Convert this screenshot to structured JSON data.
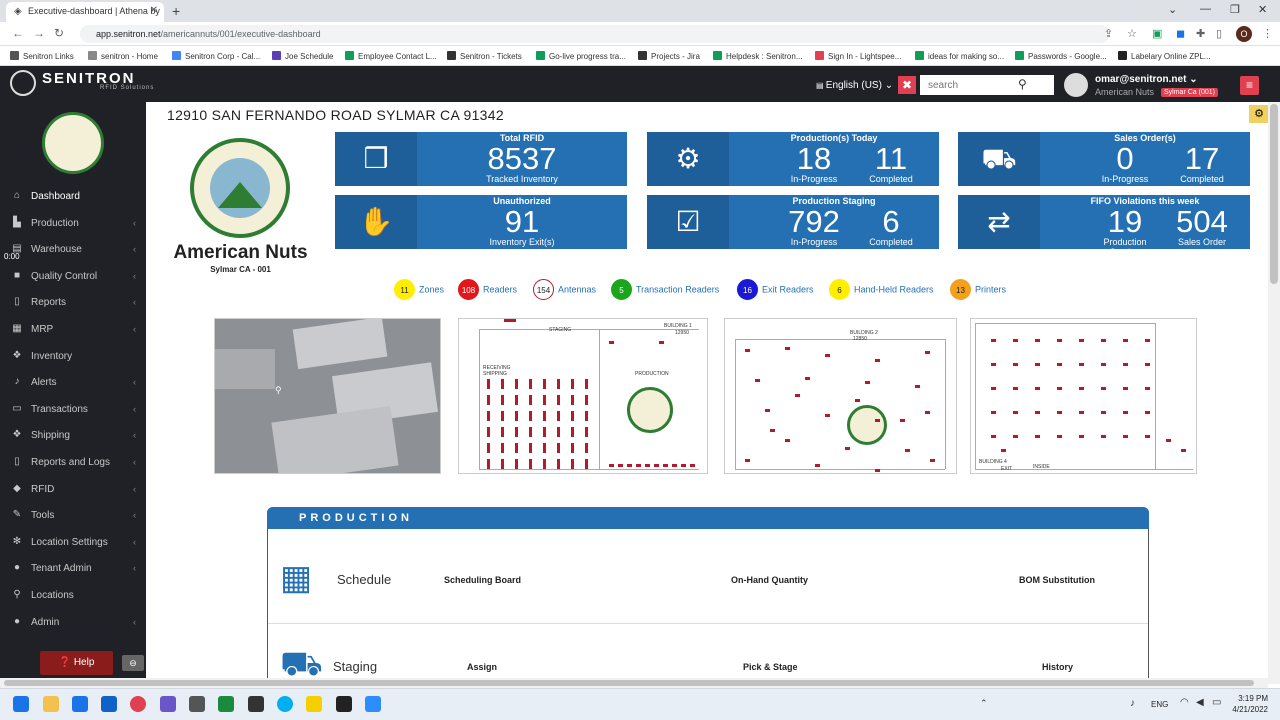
{
  "browser": {
    "tab_title": "Executive-dashboard | Athena by",
    "url_host": "app.senitron.net",
    "url_path": "/americannuts/001/executive-dashboard",
    "profile_initial": "O",
    "bookmarks": [
      {
        "label": "Senitron Links",
        "color": "#555555"
      },
      {
        "label": "senitron - Home",
        "color": "#888888"
      },
      {
        "label": "Senitron Corp - Cal...",
        "color": "#4285f4"
      },
      {
        "label": "Joe Schedule",
        "color": "#5c3fb5"
      },
      {
        "label": "Employee Contact L...",
        "color": "#0f9d58"
      },
      {
        "label": "Senitron - Tickets",
        "color": "#333333"
      },
      {
        "label": "Go-live progress tra...",
        "color": "#0f9d58"
      },
      {
        "label": "Projects - Jira",
        "color": "#333333"
      },
      {
        "label": "Helpdesk : Senitron...",
        "color": "#0f9d58"
      },
      {
        "label": "Sign In - Lightspee...",
        "color": "#e04050"
      },
      {
        "label": "ideas for making so...",
        "color": "#0f9d58"
      },
      {
        "label": "Passwords - Google...",
        "color": "#0f9d58"
      },
      {
        "label": "Labelary Online ZPL...",
        "color": "#222222"
      }
    ]
  },
  "header": {
    "brand": "SENITRON",
    "brand_sub": "RFID Solutions",
    "language": "English (US)",
    "search_placeholder": "search",
    "user_email": "omar@senitron.net",
    "tenant": "American Nuts",
    "location_badge": "Sylmar Ca (001)"
  },
  "sidebar": {
    "timer": "0:00",
    "items": [
      {
        "label": "Dashboard",
        "icon": "home-icon",
        "glyph": "⌂",
        "chevron": false,
        "active": true
      },
      {
        "label": "Production",
        "icon": "factory-icon",
        "glyph": "▙",
        "chevron": true
      },
      {
        "label": "Warehouse",
        "icon": "warehouse-icon",
        "glyph": "▤",
        "chevron": true
      },
      {
        "label": "Quality Control",
        "icon": "quality-icon",
        "glyph": "■",
        "chevron": true
      },
      {
        "label": "Reports",
        "icon": "file-icon",
        "glyph": "▯",
        "chevron": true
      },
      {
        "label": "MRP",
        "icon": "mrp-icon",
        "glyph": "▦",
        "chevron": true
      },
      {
        "label": "Inventory",
        "icon": "cubes-icon",
        "glyph": "❖",
        "chevron": false
      },
      {
        "label": "Alerts",
        "icon": "bell-icon",
        "glyph": "♪",
        "chevron": true
      },
      {
        "label": "Transactions",
        "icon": "transactions-icon",
        "glyph": "▭",
        "chevron": true
      },
      {
        "label": "Shipping",
        "icon": "shipping-icon",
        "glyph": "❖",
        "chevron": true
      },
      {
        "label": "Reports and Logs",
        "icon": "document-icon",
        "glyph": "▯",
        "chevron": true
      },
      {
        "label": "RFID",
        "icon": "tag-icon",
        "glyph": "◆",
        "chevron": true
      },
      {
        "label": "Tools",
        "icon": "wrench-icon",
        "glyph": "✎",
        "chevron": true
      },
      {
        "label": "Location Settings",
        "icon": "cog-icon",
        "glyph": "✻",
        "chevron": true
      },
      {
        "label": "Tenant Admin",
        "icon": "user-icon",
        "glyph": "●",
        "chevron": true
      },
      {
        "label": "Locations",
        "icon": "map-marker-icon",
        "glyph": "⚲",
        "chevron": false
      },
      {
        "label": "Admin",
        "icon": "admin-icon",
        "glyph": "●",
        "chevron": true
      }
    ],
    "help": "Help"
  },
  "main": {
    "address": "12910 SAN FERNANDO ROAD SYLMAR CA 91342",
    "company_name": "American Nuts",
    "company_sub": "Sylmar CA - 001",
    "cards": [
      {
        "title": "Total RFID",
        "icon": "cubes-icon",
        "glyph": "❒",
        "values": [
          {
            "v": "8537",
            "l": "Tracked Inventory"
          }
        ]
      },
      {
        "title": "Production(s) Today",
        "icon": "worker-gear-icon",
        "glyph": "⚙",
        "values": [
          {
            "v": "18",
            "l": "In-Progress"
          },
          {
            "v": "11",
            "l": "Completed"
          }
        ]
      },
      {
        "title": "Sales Order(s)",
        "icon": "conveyor-icon",
        "glyph": "⛟",
        "values": [
          {
            "v": "0",
            "l": "In-Progress"
          },
          {
            "v": "17",
            "l": "Completed"
          }
        ]
      },
      {
        "title": "Unauthorized",
        "icon": "hand-stop-icon",
        "glyph": "✋",
        "values": [
          {
            "v": "91",
            "l": "Inventory Exit(s)"
          }
        ]
      },
      {
        "title": "Production Staging",
        "icon": "clipboard-icon",
        "glyph": "☑",
        "values": [
          {
            "v": "792",
            "l": "In-Progress"
          },
          {
            "v": "6",
            "l": "Completed"
          }
        ]
      },
      {
        "title": "FIFO Violations this week",
        "icon": "flow-icon",
        "glyph": "⇄",
        "values": [
          {
            "v": "19",
            "l": "Production Staging"
          },
          {
            "v": "504",
            "l": "Sales Order"
          }
        ]
      }
    ],
    "counters": [
      {
        "count": "11",
        "label": "Zones",
        "bg": "#ffee00",
        "fg": "#222222",
        "border": "#ffee00"
      },
      {
        "count": "108",
        "label": "Readers",
        "bg": "#e3161b",
        "fg": "#ffffff",
        "border": "#e3161b"
      },
      {
        "count": "154",
        "label": "Antennas",
        "bg": "#ffffff",
        "fg": "#222222",
        "border": "#b01c2e"
      },
      {
        "count": "5",
        "label": "Transaction Readers",
        "bg": "#1aa51a",
        "fg": "#ffffff",
        "border": "#1aa51a"
      },
      {
        "count": "16",
        "label": "Exit Readers",
        "bg": "#1a1ad6",
        "fg": "#ffffff",
        "border": "#1a1ad6"
      },
      {
        "count": "6",
        "label": "Hand-Held Readers",
        "bg": "#ffee00",
        "fg": "#222222",
        "border": "#ffee00"
      },
      {
        "count": "13",
        "label": "Printers",
        "bg": "#f5a01a",
        "fg": "#222222",
        "border": "#f5a01a"
      }
    ],
    "maps": {
      "building1_label": "BUILDING 1",
      "building1_num": "12950",
      "staging_label": "STAGING",
      "production_label": "PRODUCTION",
      "receiving_label": "RECEIVING SHIPPING",
      "building2_label": "BUILDING 2",
      "building2_num": "12850",
      "building4_label": "BUILDING 4",
      "exit_label": "EXIT",
      "inside_label": "INSIDE"
    },
    "production": {
      "header": "PRODUCTION",
      "rows": [
        {
          "name": "Schedule",
          "icon": "calendar-clock-icon",
          "glyph": "▦",
          "links": [
            "Scheduling Board",
            "On-Hand Quantity",
            "BOM Substitution"
          ]
        },
        {
          "name": "Staging",
          "icon": "forklift-icon",
          "glyph": "⛟",
          "links": [
            "Assign",
            "Pick & Stage",
            "History"
          ]
        }
      ]
    }
  },
  "taskbar": {
    "lang": "ENG",
    "time": "3:19 PM",
    "date": "4/21/2022"
  }
}
